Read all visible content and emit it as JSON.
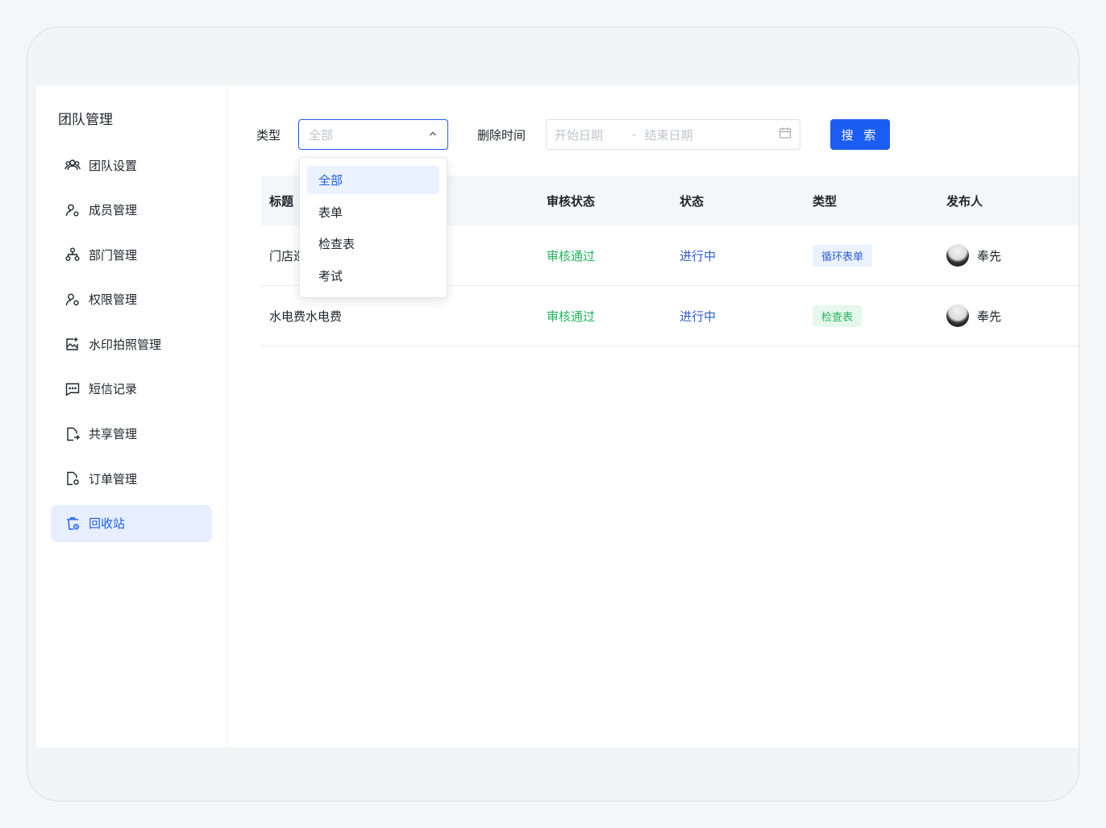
{
  "sidebar": {
    "title": "团队管理",
    "items": [
      {
        "label": "团队设置",
        "icon": "team-icon"
      },
      {
        "label": "成员管理",
        "icon": "member-icon"
      },
      {
        "label": "部门管理",
        "icon": "department-icon"
      },
      {
        "label": "权限管理",
        "icon": "permission-icon"
      },
      {
        "label": "水印拍照管理",
        "icon": "watermark-photo-icon"
      },
      {
        "label": "短信记录",
        "icon": "sms-icon"
      },
      {
        "label": "共享管理",
        "icon": "share-icon"
      },
      {
        "label": "订单管理",
        "icon": "order-icon"
      },
      {
        "label": "回收站",
        "icon": "recycle-bin-icon",
        "active": true
      }
    ]
  },
  "filters": {
    "type_label": "类型",
    "type_placeholder": "全部",
    "delete_time_label": "删除时间",
    "start_placeholder": "开始日期",
    "separator": "-",
    "end_placeholder": "结束日期",
    "search_label": "搜 索"
  },
  "dropdown": {
    "options": [
      "全部",
      "表单",
      "检查表",
      "考试"
    ],
    "selected": "全部"
  },
  "table": {
    "headers": [
      "标题",
      "审核状态",
      "状态",
      "类型",
      "发布人"
    ],
    "rows": [
      {
        "title": "门店巡",
        "audit": "审核通过",
        "status": "进行中",
        "type": "循环表单",
        "publisher": "奉先"
      },
      {
        "title": "水电费水电费",
        "audit": "审核通过",
        "status": "进行中",
        "type": "检查表",
        "publisher": "奉先"
      }
    ]
  },
  "colors": {
    "primary": "#1b5cf2",
    "success": "#22b35e",
    "active_bg": "#e6eeff"
  }
}
